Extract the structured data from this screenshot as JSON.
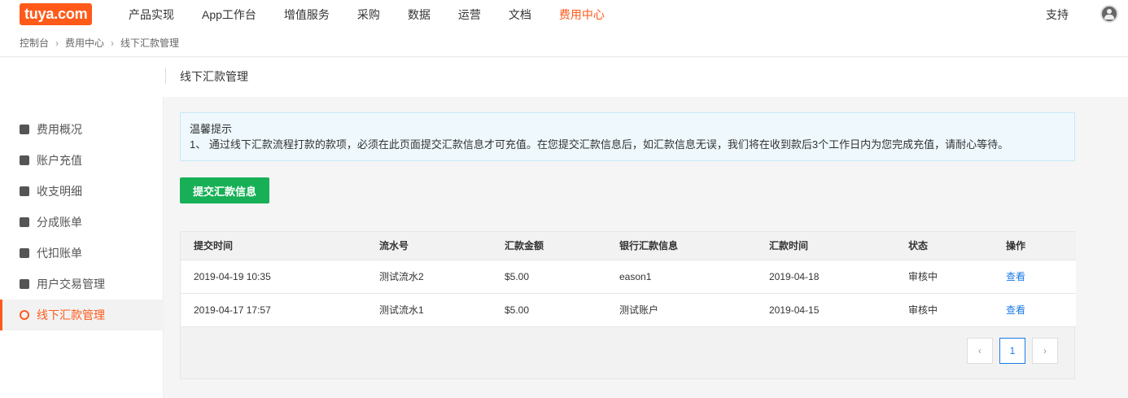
{
  "header": {
    "logo": "tuya.com",
    "nav": [
      "产品实现",
      "App工作台",
      "增值服务",
      "采购",
      "数据",
      "运营",
      "文档",
      "费用中心"
    ],
    "support": "支持"
  },
  "breadcrumb": [
    "控制台",
    "费用中心",
    "线下汇款管理"
  ],
  "page_title": "线下汇款管理",
  "sidebar": {
    "items": [
      {
        "label": "费用概况",
        "icon": "chart-icon"
      },
      {
        "label": "账户充值",
        "icon": "recharge-icon"
      },
      {
        "label": "收支明细",
        "icon": "wallet-icon"
      },
      {
        "label": "分成账单",
        "icon": "bill-icon"
      },
      {
        "label": "代扣账单",
        "icon": "deduct-icon"
      },
      {
        "label": "用户交易管理",
        "icon": "trade-icon"
      },
      {
        "label": "线下汇款管理",
        "icon": "remit-icon",
        "active": true
      }
    ]
  },
  "notice": {
    "title": "温馨提示",
    "text": "1、 通过线下汇款流程打款的款项，必须在此页面提交汇款信息才可充值。在您提交汇款信息后，如汇款信息无误，我们将在收到款后3个工作日内为您完成充值，请耐心等待。"
  },
  "submit_button": "提交汇款信息",
  "table": {
    "columns": [
      "提交时间",
      "流水号",
      "汇款金额",
      "银行汇款信息",
      "汇款时间",
      "状态",
      "操作"
    ],
    "rows": [
      [
        "2019-04-19 10:35",
        "测试流水2",
        "$5.00",
        "eason1",
        "2019-04-18",
        "审核中",
        "查看"
      ],
      [
        "2019-04-17 17:57",
        "测试流水1",
        "$5.00",
        "测试账户",
        "2019-04-15",
        "审核中",
        "查看"
      ]
    ]
  },
  "pagination": {
    "current": "1",
    "prev": "‹",
    "next": "›"
  },
  "colors": {
    "brand": "#ff5a1a",
    "primary_button": "#18b057",
    "link": "#1a7ae6"
  }
}
